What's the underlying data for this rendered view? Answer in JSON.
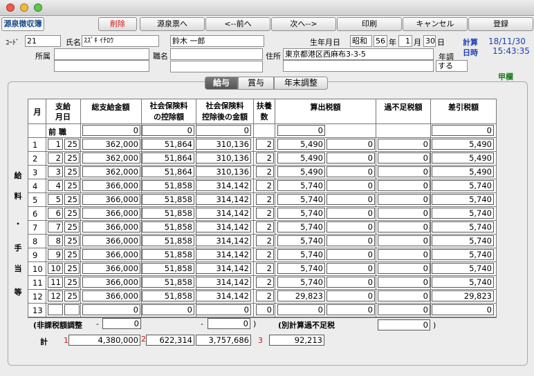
{
  "toolbar": {
    "app_title": "源泉徴収簿",
    "delete": "削除",
    "to_slip": "源泉票へ",
    "prev": "<--前へ",
    "next": "次へ-->",
    "print": "印刷",
    "cancel": "キャンセル",
    "register": "登録"
  },
  "employee": {
    "code_label": "ｺｰﾄﾞ",
    "code": "21",
    "name_label": "氏名",
    "name_kana": "ｽｽﾞｷ ｲﾁﾛｳ",
    "name": "鈴木 一郎",
    "birth_label": "生年月日",
    "era": "昭和",
    "year": "56",
    "year_unit": "年",
    "month": "1",
    "month_unit": "月",
    "day": "30",
    "day_unit": "日",
    "dept_label": "所属",
    "post_label": "職名",
    "address_label": "住所",
    "address": "東京都港区西麻布3-3-5",
    "nencho_label": "年調",
    "nencho_value": "する",
    "kou": "甲欄"
  },
  "calc": {
    "label": "計算",
    "date": "18/11/30",
    "time_label": "日時",
    "time": "15:43:35"
  },
  "tabs": [
    "給与",
    "賞与",
    "年末調整"
  ],
  "side_label": [
    "給",
    "料",
    "・",
    "手",
    "当",
    "等"
  ],
  "headers": {
    "month": "月",
    "pay_day_1": "支給",
    "pay_day_2": "月日",
    "total_pay": "総支給金額",
    "ins_1": "社会保険料",
    "ins_2": "の控除額",
    "after_1": "社会保険料",
    "after_2": "控除後の金額",
    "dep_1": "扶養",
    "dep_2": "数",
    "tax": "算出税額",
    "short": "過不足税額",
    "net": "差引税額"
  },
  "prev_job": {
    "label": "前 職",
    "total_pay": "0",
    "ins": "0",
    "after": "0",
    "tax": "0",
    "net": "0"
  },
  "rows": [
    {
      "m": "1",
      "pm": "1",
      "pd": "25",
      "pay": "362,000",
      "ins": "51,864",
      "aft": "310,136",
      "dep": "2",
      "tax": "5,490",
      "t2": "0",
      "sh": "0",
      "net": "5,490"
    },
    {
      "m": "2",
      "pm": "2",
      "pd": "25",
      "pay": "362,000",
      "ins": "51,864",
      "aft": "310,136",
      "dep": "2",
      "tax": "5,490",
      "t2": "0",
      "sh": "0",
      "net": "5,490"
    },
    {
      "m": "3",
      "pm": "3",
      "pd": "25",
      "pay": "362,000",
      "ins": "51,864",
      "aft": "310,136",
      "dep": "2",
      "tax": "5,490",
      "t2": "0",
      "sh": "0",
      "net": "5,490"
    },
    {
      "m": "4",
      "pm": "4",
      "pd": "25",
      "pay": "366,000",
      "ins": "51,858",
      "aft": "314,142",
      "dep": "2",
      "tax": "5,740",
      "t2": "0",
      "sh": "0",
      "net": "5,740"
    },
    {
      "m": "5",
      "pm": "5",
      "pd": "25",
      "pay": "366,000",
      "ins": "51,858",
      "aft": "314,142",
      "dep": "2",
      "tax": "5,740",
      "t2": "0",
      "sh": "0",
      "net": "5,740"
    },
    {
      "m": "6",
      "pm": "6",
      "pd": "25",
      "pay": "366,000",
      "ins": "51,858",
      "aft": "314,142",
      "dep": "2",
      "tax": "5,740",
      "t2": "0",
      "sh": "0",
      "net": "5,740"
    },
    {
      "m": "7",
      "pm": "7",
      "pd": "25",
      "pay": "366,000",
      "ins": "51,858",
      "aft": "314,142",
      "dep": "2",
      "tax": "5,740",
      "t2": "0",
      "sh": "0",
      "net": "5,740"
    },
    {
      "m": "8",
      "pm": "8",
      "pd": "25",
      "pay": "366,000",
      "ins": "51,858",
      "aft": "314,142",
      "dep": "2",
      "tax": "5,740",
      "t2": "0",
      "sh": "0",
      "net": "5,740"
    },
    {
      "m": "9",
      "pm": "9",
      "pd": "25",
      "pay": "366,000",
      "ins": "51,858",
      "aft": "314,142",
      "dep": "2",
      "tax": "5,740",
      "t2": "0",
      "sh": "0",
      "net": "5,740"
    },
    {
      "m": "10",
      "pm": "10",
      "pd": "25",
      "pay": "366,000",
      "ins": "51,858",
      "aft": "314,142",
      "dep": "2",
      "tax": "5,740",
      "t2": "0",
      "sh": "0",
      "net": "5,740"
    },
    {
      "m": "11",
      "pm": "11",
      "pd": "25",
      "pay": "366,000",
      "ins": "51,858",
      "aft": "314,142",
      "dep": "2",
      "tax": "5,740",
      "t2": "0",
      "sh": "0",
      "net": "5,740"
    },
    {
      "m": "12",
      "pm": "12",
      "pd": "25",
      "pay": "366,000",
      "ins": "51,858",
      "aft": "314,142",
      "dep": "2",
      "tax": "29,823",
      "t2": "0",
      "sh": "0",
      "net": "29,823"
    },
    {
      "m": "13",
      "pm": "",
      "pd": "",
      "pay": "0",
      "ins": "0",
      "aft": "0",
      "dep": "0",
      "tax": "0",
      "t2": "0",
      "sh": "0",
      "net": "0"
    }
  ],
  "footer": {
    "nontax_label": "(非課税額調整",
    "minus1": "-",
    "nontax_val1": "0",
    "minus2": "-",
    "nontax_val2": "0",
    "close1": ")",
    "separate_label": "(別計算過不足税",
    "separate_val": "0",
    "close2": ")",
    "total_label": "計",
    "mark1": "1",
    "total_pay": "4,380,000",
    "mark2": "2",
    "total_ins": "622,314",
    "total_after": "3,757,686",
    "mark3": "3",
    "total_tax": "92,213"
  },
  "colors": {
    "accent_red": "#d01010",
    "accent_blue": "#1d3fb0"
  }
}
